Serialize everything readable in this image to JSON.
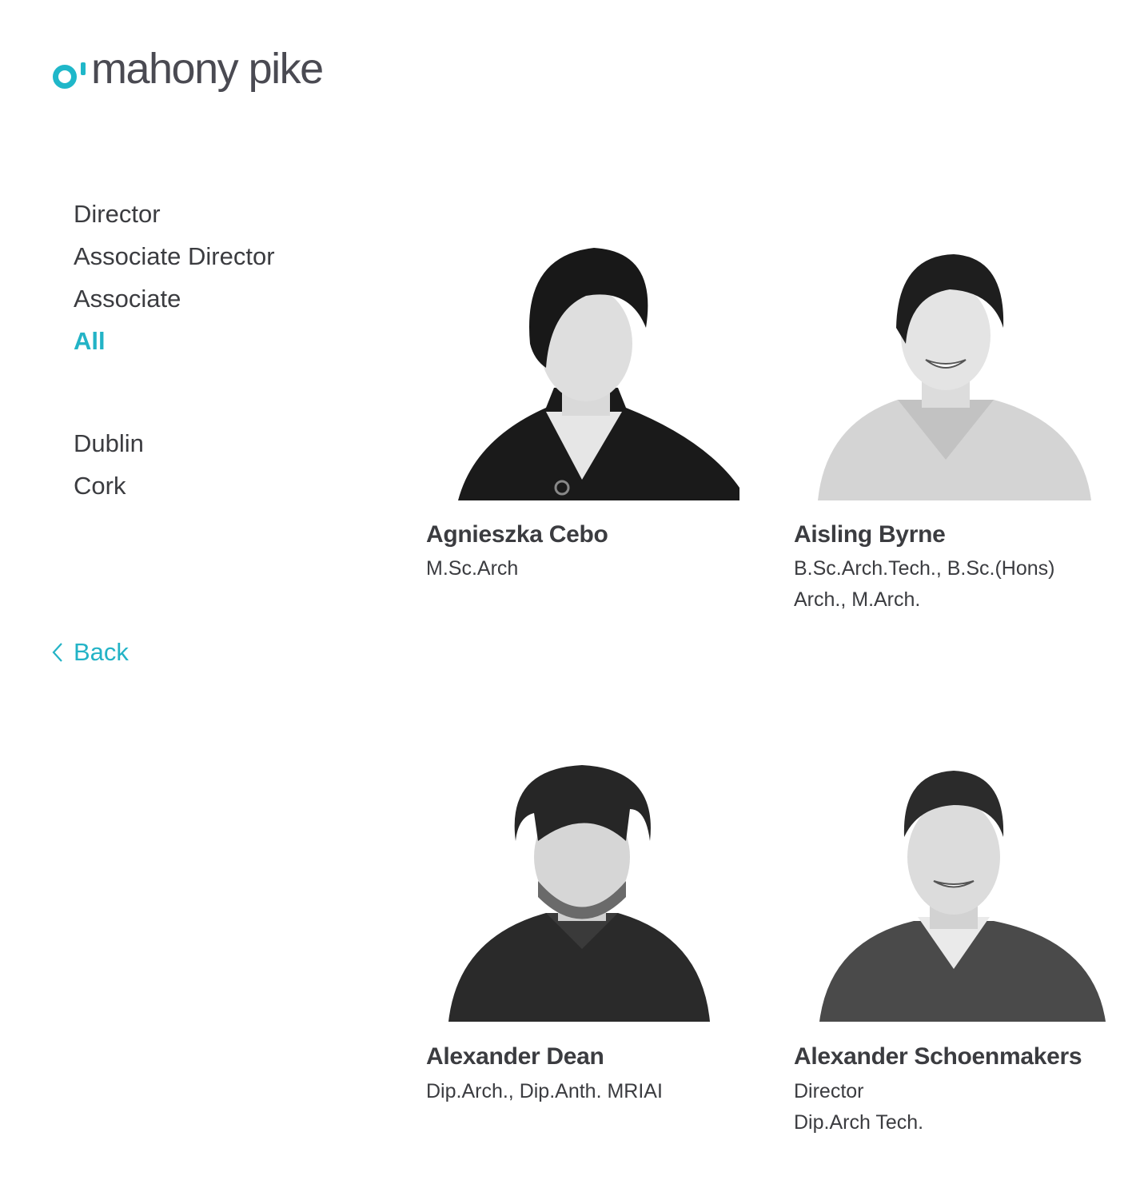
{
  "brand": {
    "name": "mahony pike",
    "accent": "#1fb7c9",
    "logo_mark": "o-ring-and-tick"
  },
  "filters": {
    "roles": [
      "Director",
      "Associate Director",
      "Associate",
      "All"
    ],
    "active_role": "All",
    "locations": [
      "Dublin",
      "Cork"
    ]
  },
  "back": {
    "label": "Back",
    "icon": "chevron-left-icon"
  },
  "people": [
    {
      "name": "Agnieszka Cebo",
      "quals": [
        "M.Sc.Arch"
      ]
    },
    {
      "name": "Aisling Byrne",
      "quals": [
        "B.Sc.Arch.Tech., B.Sc.(Hons)",
        "Arch., M.Arch."
      ]
    },
    {
      "name": "Alexander Dean",
      "quals": [
        "Dip.Arch., Dip.Anth. MRIAI"
      ]
    },
    {
      "name": "Alexander Schoenmakers",
      "quals": [
        "Director",
        "Dip.Arch Tech."
      ]
    }
  ]
}
